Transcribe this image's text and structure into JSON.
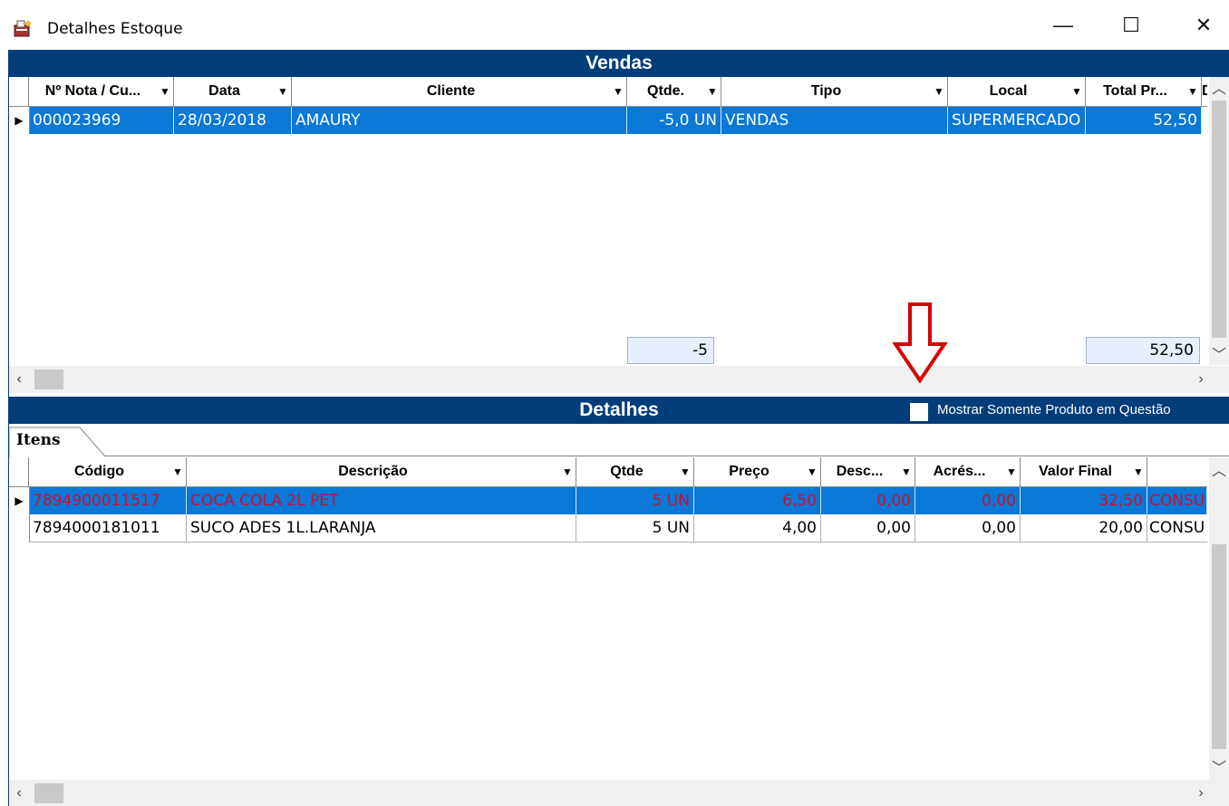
{
  "window": {
    "title": "Detalhes Estoque",
    "minimize_glyph": "—",
    "maximize_glyph": "☐",
    "close_glyph": "✕"
  },
  "vendas": {
    "heading": "Vendas",
    "columns": [
      "Nº Nota / Cu...",
      "Data",
      "Cliente",
      "Qtde.",
      "Tipo",
      "Local",
      "Total Pr...",
      "D"
    ],
    "rows": [
      {
        "nota": "000023969",
        "data": "28/03/2018",
        "cliente": "AMAURY",
        "qtde": "-5,0 UN",
        "tipo": "VENDAS",
        "local": "SUPERMERCADO",
        "total": "52,50"
      }
    ],
    "footer": {
      "qtde_total": "-5",
      "valor_total": "52,50"
    }
  },
  "detalhes": {
    "heading": "Detalhes",
    "checkbox_label": "Mostrar  Somente Produto em Questão",
    "checkbox_checked": false,
    "tab_label": "Itens",
    "columns": [
      "Código",
      "Descrição",
      "Qtde",
      "Preço",
      "Desc...",
      "Acrés...",
      "Valor Final"
    ],
    "rows": [
      {
        "codigo": "7894900011517",
        "descricao": "COCA COLA 2L PET",
        "qtde": "5 UN",
        "preco": "6,50",
        "desc": "0,00",
        "acres": "0,00",
        "valor": "32,50",
        "extra": "CONSU"
      },
      {
        "codigo": "7894000181011",
        "descricao": "SUCO ADES 1L.LARANJA",
        "qtde": "5 UN",
        "preco": "4,00",
        "desc": "0,00",
        "acres": "0,00",
        "valor": "20,00",
        "extra": "CONSU"
      }
    ]
  },
  "colors": {
    "header_blue": "#003d7a",
    "selection_blue": "#0a78d7",
    "annotation_red": "#d40000",
    "highlight_text_red": "#c8102e"
  },
  "icons": [
    "app-icon",
    "minimize-icon",
    "maximize-icon",
    "close-icon",
    "dropdown-arrow-icon",
    "row-indicator-icon",
    "down-arrow-annotation-icon",
    "scroll-up-icon",
    "scroll-down-icon",
    "scroll-left-icon",
    "scroll-right-icon"
  ]
}
